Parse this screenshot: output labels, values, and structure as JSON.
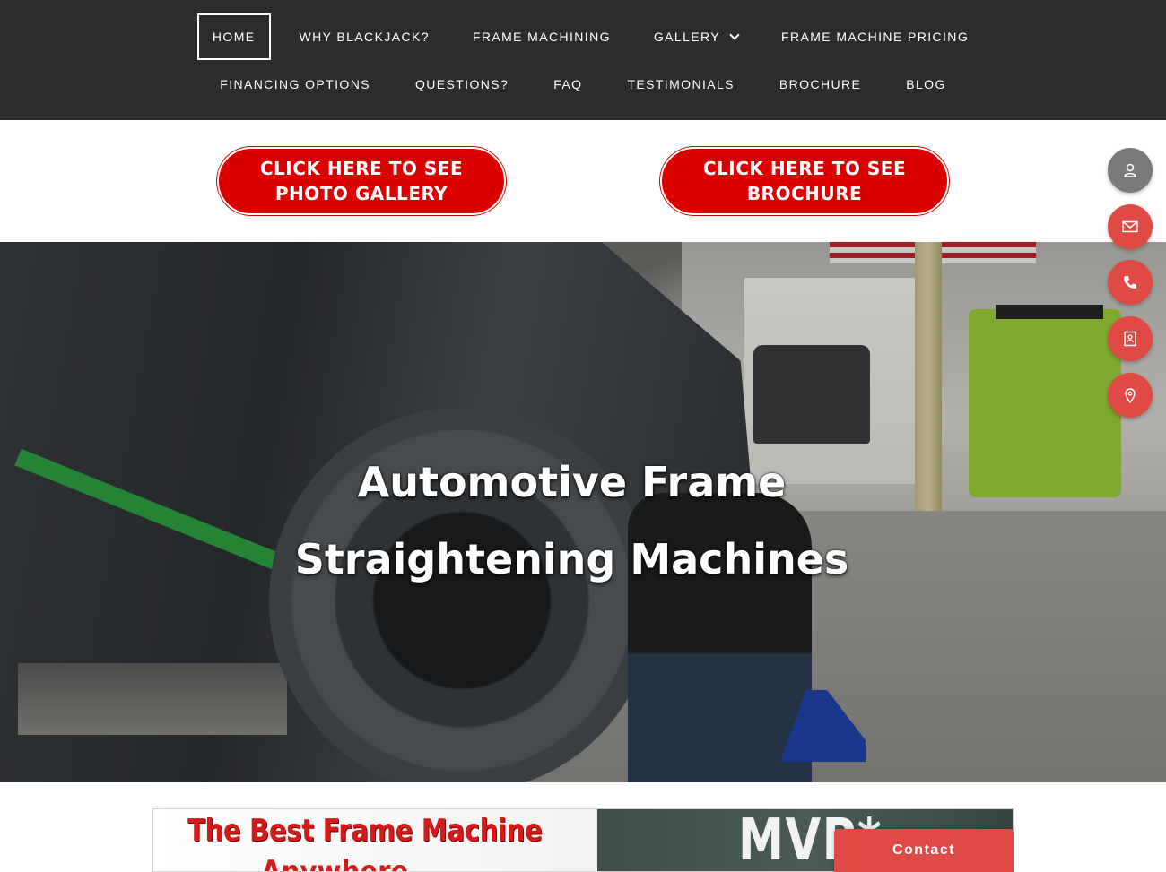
{
  "nav": {
    "row1": [
      {
        "label": "HOME",
        "active": true
      },
      {
        "label": "WHY BLACKJACK?"
      },
      {
        "label": "FRAME MACHINING"
      },
      {
        "label": "GALLERY",
        "dropdown": true
      },
      {
        "label": "FRAME MACHINE PRICING"
      }
    ],
    "row2": [
      {
        "label": "FINANCING OPTIONS"
      },
      {
        "label": "QUESTIONS?"
      },
      {
        "label": "FAQ"
      },
      {
        "label": "TESTIMONIALS"
      },
      {
        "label": "BROCHURE"
      },
      {
        "label": "BLOG"
      }
    ]
  },
  "cta": {
    "photo_gallery": "CLICK HERE TO SEE PHOTO GALLERY",
    "brochure": "CLICK HERE TO SEE BROCHURE"
  },
  "hero": {
    "title_line1": "Automotive Frame",
    "title_line2": "Straightening Machines"
  },
  "side_icons": [
    "person-icon",
    "mail-icon",
    "phone-icon",
    "contact-card-icon",
    "location-pin-icon"
  ],
  "banner": {
    "line1": "The Best Frame Machine",
    "line2": "Anywhere",
    "badge": "MVP*"
  },
  "contact_tab": {
    "label": "Contact"
  },
  "colors": {
    "nav_bg": "#2c2c2c",
    "cta_red": "#dc0000",
    "side_red": "#e04a44",
    "side_grey": "#7a7a7a"
  }
}
